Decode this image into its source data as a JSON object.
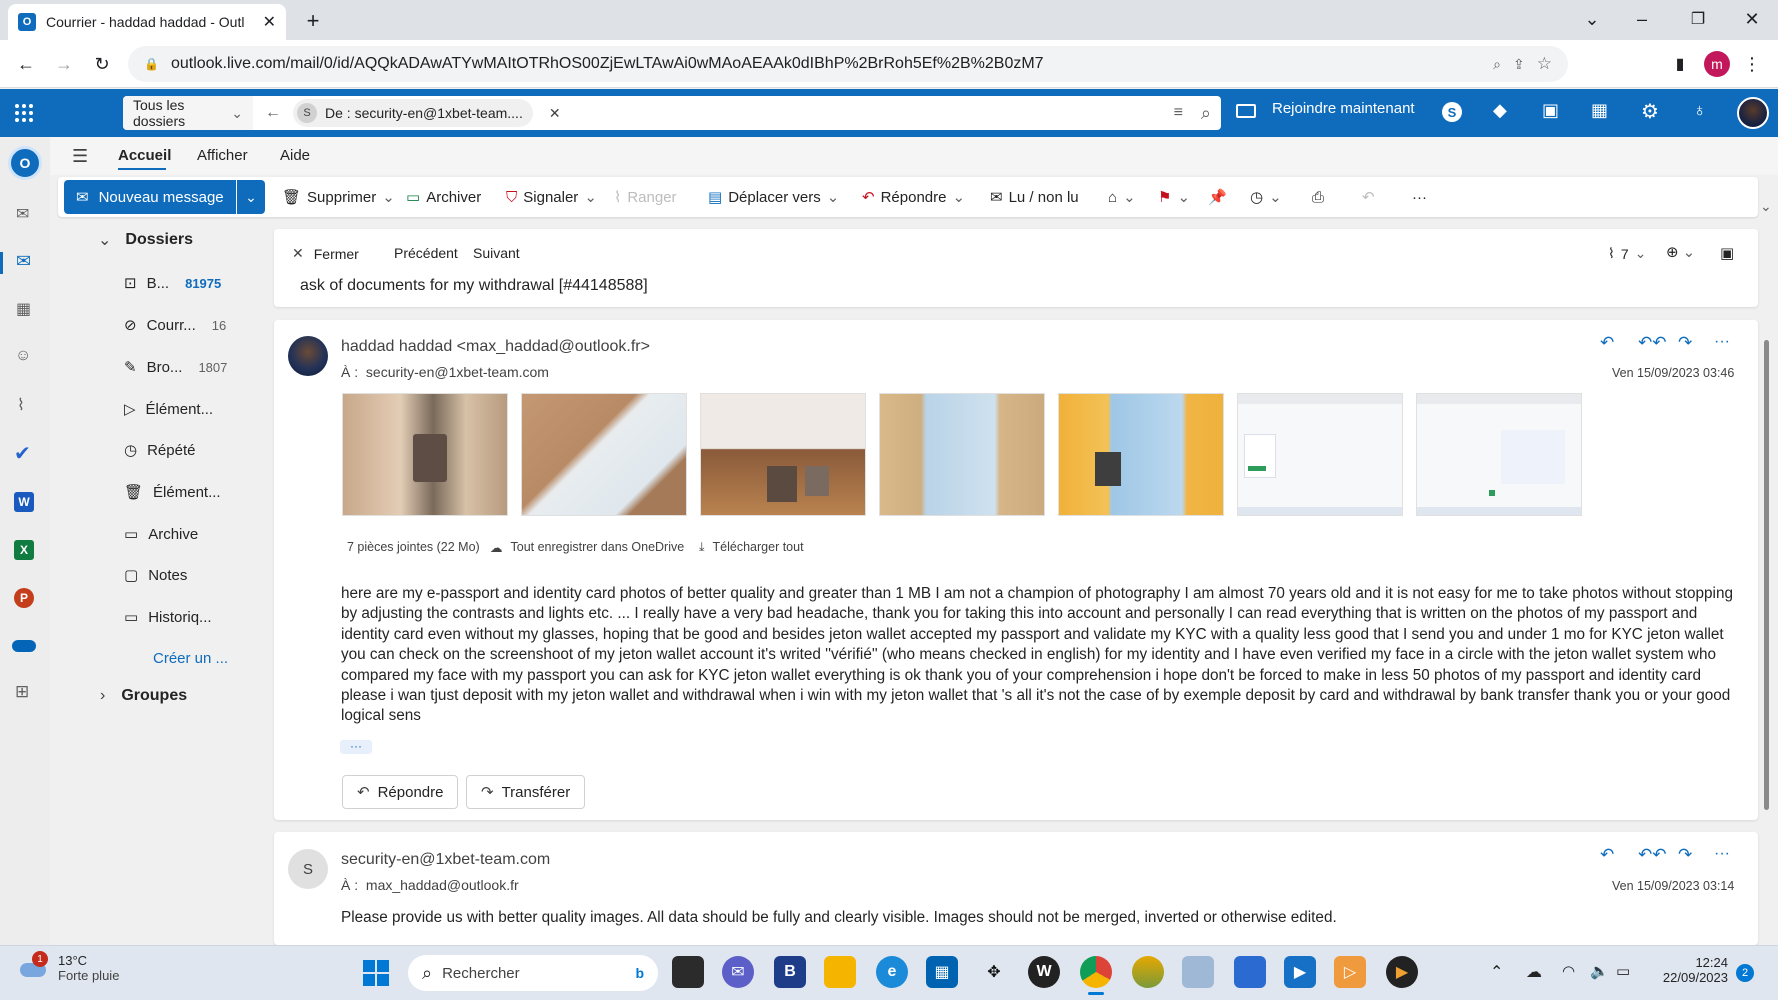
{
  "browser": {
    "tab_title": "Courrier - haddad haddad - Outl",
    "url": "outlook.live.com/mail/0/id/AQQkADAwATYwMAItOTRhOS00ZjEwLTAwAi0wMAoAEAAk0dIBhP%2BrRoh5Ef%2B%2B0zM7",
    "profile_initial": "m"
  },
  "outlook_header": {
    "scope_label": "Tous les dossiers",
    "search_chip_initial": "S",
    "search_chip_text": "De : security-en@1xbet-team....",
    "join_label": "Rejoindre maintenant"
  },
  "ribbon": {
    "tabs": [
      "Accueil",
      "Afficher",
      "Aide"
    ],
    "new_message": "Nouveau message",
    "delete": "Supprimer",
    "archive": "Archiver",
    "report": "Signaler",
    "sweep": "Ranger",
    "move": "Déplacer vers",
    "reply": "Répondre",
    "read_unread": "Lu / non lu",
    "more": "···"
  },
  "folders": {
    "header": "Dossiers",
    "items": [
      {
        "label": "B...",
        "count": "81975"
      },
      {
        "label": "Courr...",
        "count": "16"
      },
      {
        "label": "Bro...",
        "count": "1807"
      },
      {
        "label": "Élément...",
        "count": ""
      },
      {
        "label": "Répété",
        "count": ""
      },
      {
        "label": "Élément...",
        "count": ""
      },
      {
        "label": "Archive",
        "count": ""
      },
      {
        "label": "Notes",
        "count": ""
      },
      {
        "label": "Historiq...",
        "count": ""
      }
    ],
    "create": "Créer un ...",
    "groups": "Groupes"
  },
  "reading": {
    "close": "Fermer",
    "prev": "Précédent",
    "next": "Suivant",
    "attach_count": "7",
    "subject": "ask of documents for my withdrawal [#44148588]"
  },
  "message1": {
    "from": "haddad haddad <max_haddad@outlook.fr>",
    "to_label": "À :",
    "to": "security-en@1xbet-team.com",
    "date": "Ven 15/09/2023 03:46",
    "attachments_summary": "7 pièces jointes (22 Mo)",
    "save_onedrive": "Tout enregistrer dans OneDrive",
    "download_all": "Télécharger tout",
    "body": "here are my e-passport and identity card photos of better quality and greater than 1 MB I am not  a champion of photography I am almost 70 years old and it is not easy for me to take photos without stopping by adjusting the contrasts and lights etc. ... I really have a very bad headache, thank you for taking this into account and personally I can read everything that is written on the photos of my passport and identity card even without my glasses, hoping  that be good and besides jeton wallet accepted my passport and validate my KYC with a quality  less good that I send you and under   1 mo for KYC jeton wallet   you can check on the screenshoot of my jeton wallet account  it's writed ''vérifié''  (who means checked in english) for my identity  and I have  even verified my face in a  circle with the jeton  wallet system who compared my face with my passport you can ask for KYC jeton  wallet everything is ok  thank you of your comprehension  i hope don't be forced to make in less 50 photos of my passport and identity card please   i wan tjust deposit with my jeton wallet and withdrawal when i win with my jeton wallet that 's all it's not the case of by exemple deposit by card and withdrawal by bank transfer  thank you or your good logical sens",
    "ellipsis": "···",
    "reply_btn": "Répondre",
    "forward_btn": "Transférer"
  },
  "message2": {
    "avatar_initial": "S",
    "from": "security-en@1xbet-team.com",
    "to_label": "À :",
    "to": "max_haddad@outlook.fr",
    "date": "Ven 15/09/2023 03:14",
    "body": "Please provide us with better quality images. All data should be fully and clearly visible. Images should not be merged, inverted or otherwise edited."
  },
  "taskbar": {
    "weather_temp": "13°C",
    "weather_desc": "Forte pluie",
    "weather_badge": "1",
    "search_placeholder": "Rechercher",
    "time": "12:24",
    "date": "22/09/2023",
    "notif_count": "2"
  }
}
